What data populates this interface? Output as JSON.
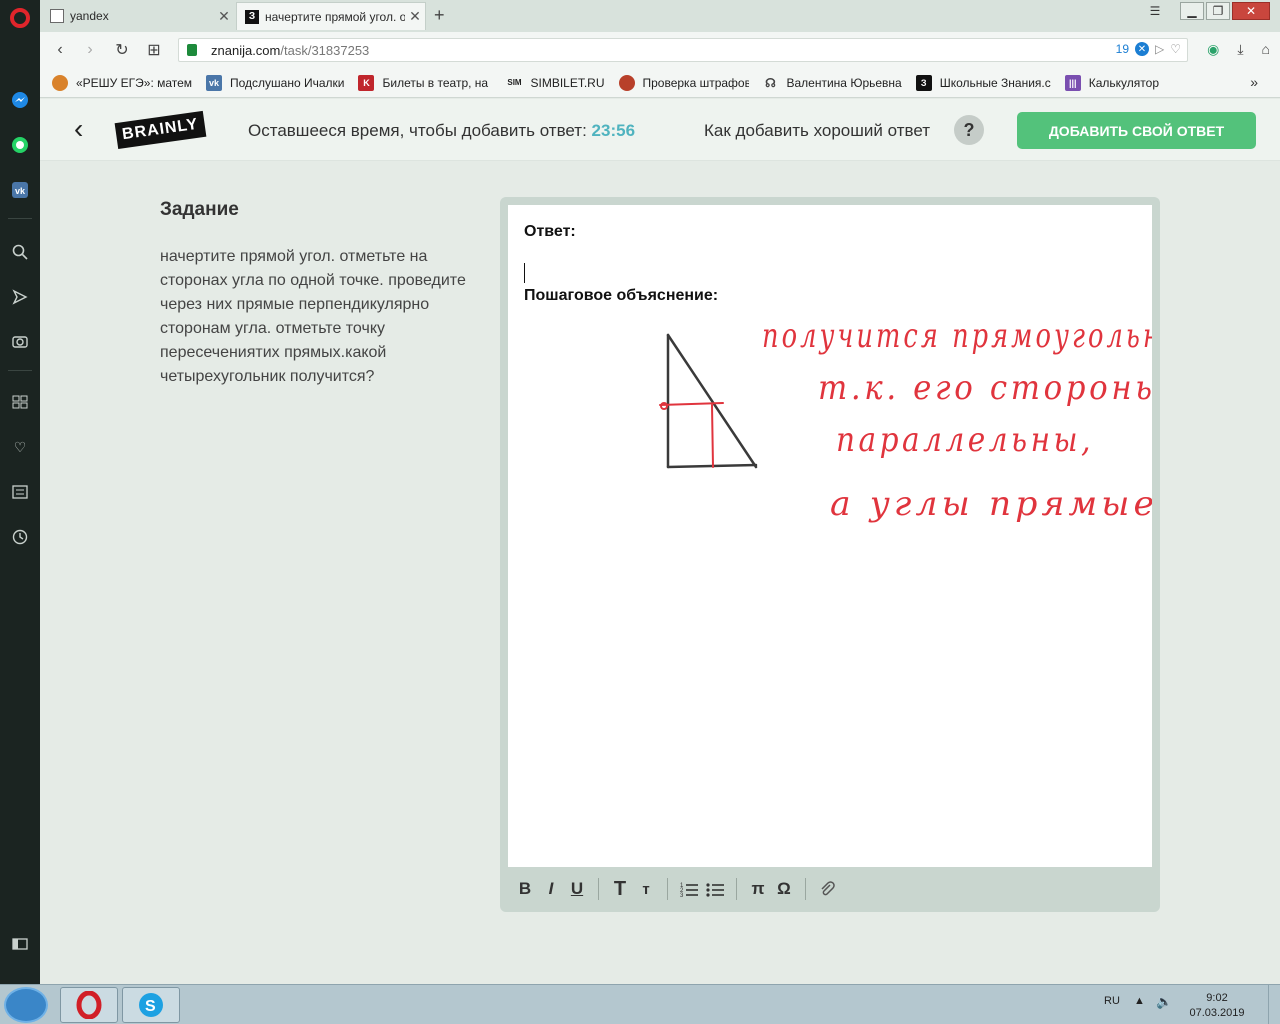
{
  "browser": {
    "tabs": [
      {
        "title": "yandex",
        "active": false
      },
      {
        "title": "начертите прямой угол. о",
        "active": true
      }
    ],
    "url_host": "znanija.com",
    "url_path": "/task/31837253",
    "adblock_count": "19",
    "bookmarks": [
      {
        "label": "«РЕШУ ЕГЭ»: матема",
        "icon": "reshu-icon",
        "color": "#d9822b"
      },
      {
        "label": "Подслушано Ичалки",
        "icon": "vk-icon",
        "color": "#4a76a8"
      },
      {
        "label": "Билеты в театр, на к",
        "icon": "kassa-icon",
        "color": "#c0262c"
      },
      {
        "label": "SIMBILET.RU",
        "icon": "sim-icon",
        "color": "#333333"
      },
      {
        "label": "Проверка штрафов",
        "icon": "gibdd-icon",
        "color": "#b8402a"
      },
      {
        "label": "Валентина Юрьевна",
        "icon": "headset-icon",
        "color": "#444444"
      },
      {
        "label": "Школьные Знания.с",
        "icon": "znanija-icon",
        "color": "#111111"
      },
      {
        "label": "Калькулятор",
        "icon": "calc-icon",
        "color": "#7a4fb0"
      }
    ]
  },
  "header": {
    "timer_label": "Оставшееся время, чтобы добавить ответ: ",
    "timer_value": "23:56",
    "howto": "Как добавить хороший ответ",
    "help": "?",
    "add_answer": "ДОБАВИТЬ СВОЙ ОТВЕТ",
    "brand": "BRAINLY"
  },
  "task": {
    "title": "Задание",
    "text": "начертите прямой угол. отметьте на сторонах угла по одной точке. проведите через них прямые перпендикулярно сторонам угла. отметьте точку пересеченият­их прямых.какой четырехугольник получится?"
  },
  "editor": {
    "answer_label": "Ответ:",
    "explanation_label": "Пошаговое объяснение:",
    "handwriting": [
      "получится прямоугольник,",
      "т.к. его стороны",
      "параллельны,",
      "а углы прямые"
    ],
    "toolbar": [
      "B",
      "I",
      "U",
      "T",
      "т",
      "≡",
      "≣",
      "π",
      "Ω",
      "⌀"
    ]
  },
  "taskbar": {
    "lang": "RU",
    "time": "9:02",
    "date": "07.03.2019"
  },
  "colors": {
    "accent_green": "#53c27b",
    "timer_blue": "#4fb3bf",
    "ink_red": "#e0343d"
  }
}
